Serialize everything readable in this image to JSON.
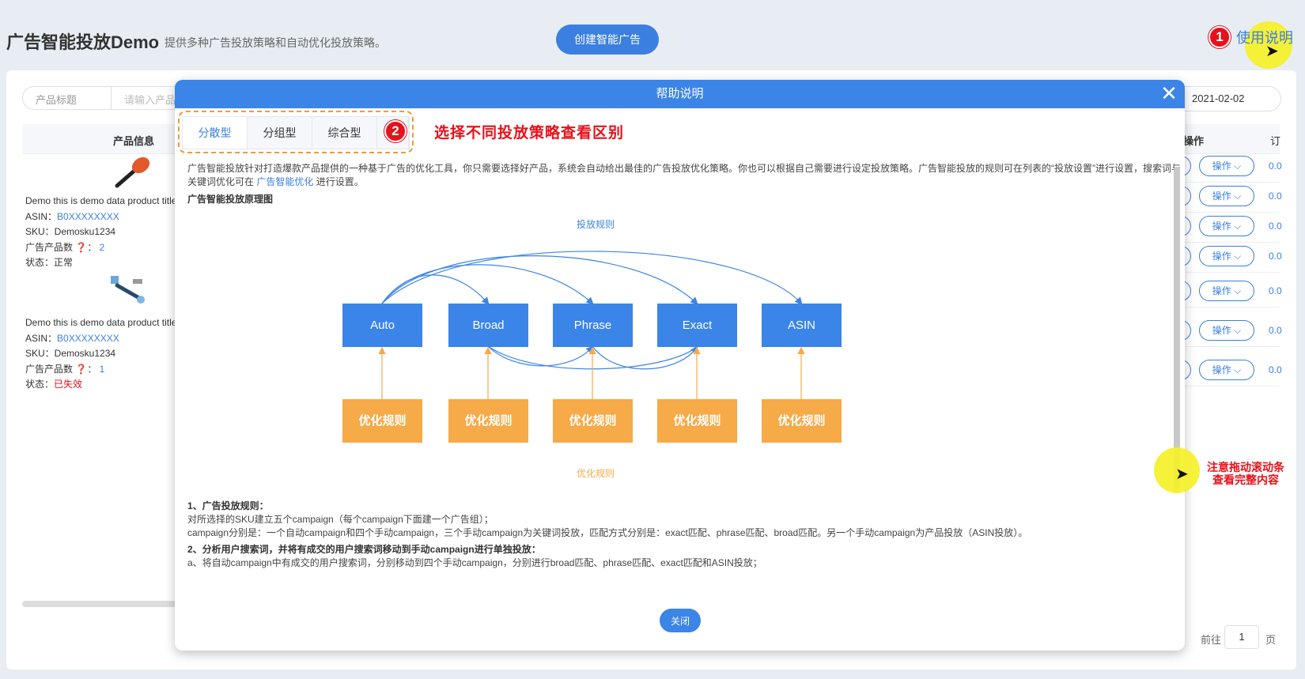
{
  "header": {
    "title": "广告智能投放Demo",
    "subtitle": "提供多种广告投放策略和自动优化投放策略。",
    "create_button": "创建智能广告",
    "help_link": "使用说明",
    "badge_1": "1",
    "badge_2": "2"
  },
  "filters": {
    "select_value": "产品标题",
    "input_placeholder": "请输入产品",
    "date_value": "2021-02-02"
  },
  "table": {
    "col_product": "产品信息",
    "col_op": "操作",
    "col_stub": "订",
    "op_label": "操作",
    "col_stub_value": "0.0",
    "rows": [
      {
        "title": "Demo this is demo data product title",
        "asin_label": "ASIN：",
        "asin": "B0XXXXXXXX",
        "sku": "SKU：Demosku1234",
        "ad_count_label": "广告产品数",
        "ad_count": "2",
        "status_label": "状态：",
        "status": "正常"
      },
      {
        "title": "Demo this is demo data product title",
        "asin_label": "ASIN：",
        "asin": "B0XXXXXXXX",
        "sku": "SKU：Demosku1234",
        "ad_count_label": "广告产品数",
        "ad_count": "1",
        "status_label": "状态：",
        "status": "已失效"
      }
    ]
  },
  "pager": {
    "goto": "前往",
    "page": "1",
    "unit": "页"
  },
  "dialog": {
    "title": "帮助说明",
    "tabs": [
      "分散型",
      "分组型",
      "综合型"
    ],
    "tab_note": "选择不同投放策略查看区别",
    "intro_1": "广告智能投放针对打造爆款产品提供的一种基于广告的优化工具，你只需要选择好产品，系统会自动给出最佳的广告投放优化策略。你也可以根据自己需要进行设定投放策略。广告智能投放的规则可在列表的“投放设置”进行设置，搜索词与",
    "intro_2a": "关键词优化可在",
    "intro_link": "广告智能优化",
    "intro_2b": "进行设置。",
    "diagram_title": "广告智能投放原理图",
    "rule_top": "投放规则",
    "rule_bottom": "优化规则",
    "nodes": [
      "Auto",
      "Broad",
      "Phrase",
      "Exact",
      "ASIN"
    ],
    "opt_nodes": [
      "优化规则",
      "优化规则",
      "优化规则",
      "优化规则",
      "优化规则"
    ],
    "s1_title": "1、广告投放规则：",
    "s1_l1": "对所选择的SKU建立五个campaign（每个campaign下面建一个广告组）；",
    "s1_l2": "campaign分别是：一个自动campaign和四个手动campaign，三个手动campaign为关键词投放，匹配方式分别是：exact匹配、phrase匹配、broad匹配。另一个手动campaign为产品投放（ASIN投放）。",
    "s2_title": "2、分析用户搜索词，并将有成交的用户搜索词移动到手动campaign进行单独投放：",
    "s2_l1": "a、将自动campaign中有成交的用户搜索词，分别移动到四个手动campaign，分别进行broad匹配、phrase匹配、exact匹配和ASIN投放；",
    "ok_button": "关闭"
  },
  "scroll_note": {
    "line1": "注意拖动滚动条",
    "line2": "查看完整内容"
  },
  "colors": {
    "primary": "#3b84e8",
    "orange": "#f6aa48",
    "annotation_red": "#e8101a",
    "highlight_yellow": "#f5f028"
  }
}
